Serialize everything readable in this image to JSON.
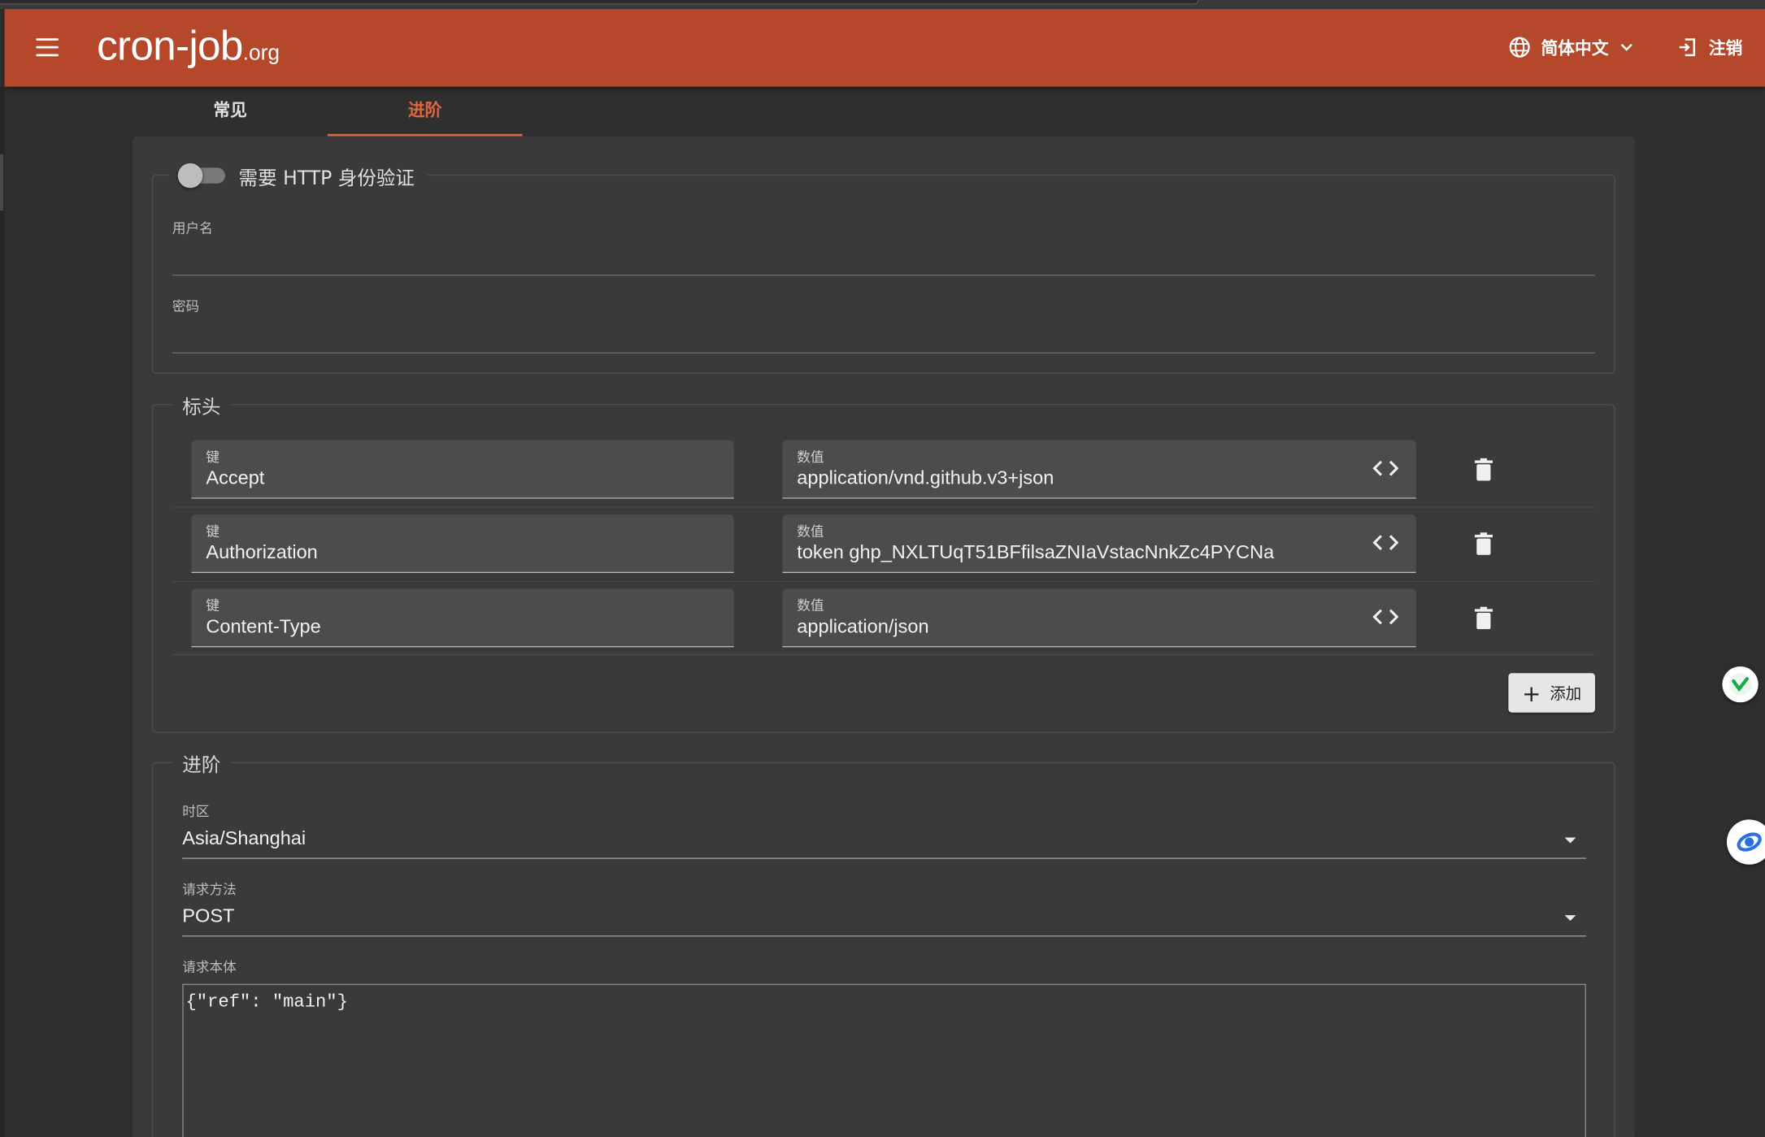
{
  "app": {
    "logo_main": "cron-job",
    "logo_tld": ".org",
    "language": "简体中文",
    "logout": "注销"
  },
  "tabs": [
    {
      "label": "常见",
      "active": false
    },
    {
      "label": "进阶",
      "active": true
    }
  ],
  "auth": {
    "toggle_label": "需要 HTTP 身份验证",
    "enabled": false,
    "username_label": "用户名",
    "username_value": "",
    "password_label": "密码",
    "password_value": ""
  },
  "headers": {
    "legend": "标头",
    "key_label": "键",
    "value_label": "数值",
    "rows": [
      {
        "key": "Accept",
        "value": "application/vnd.github.v3+json"
      },
      {
        "key": "Authorization",
        "value": "token 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"
      },
      {
        "key": "Content-Type",
        "value": "application/json"
      }
    ],
    "add_label": "添加"
  },
  "advanced": {
    "legend": "进阶",
    "timezone_label": "时区",
    "timezone_value": "Asia/Shanghai",
    "method_label": "请求方法",
    "method_value": "POST",
    "body_label": "请求本体",
    "body_value": "{\"ref\": \"main\"}"
  },
  "colors": {
    "appbar": "#b5472a",
    "accent": "#e0663f",
    "background": "#2f2f2f",
    "card": "#3a3a3a"
  },
  "icons": {
    "menu": "menu-icon",
    "language": "globe-icon",
    "logout": "logout-icon",
    "code": "code-brackets-icon",
    "delete": "trash-icon",
    "add": "plus-icon",
    "dropdown": "caret-down-icon"
  }
}
